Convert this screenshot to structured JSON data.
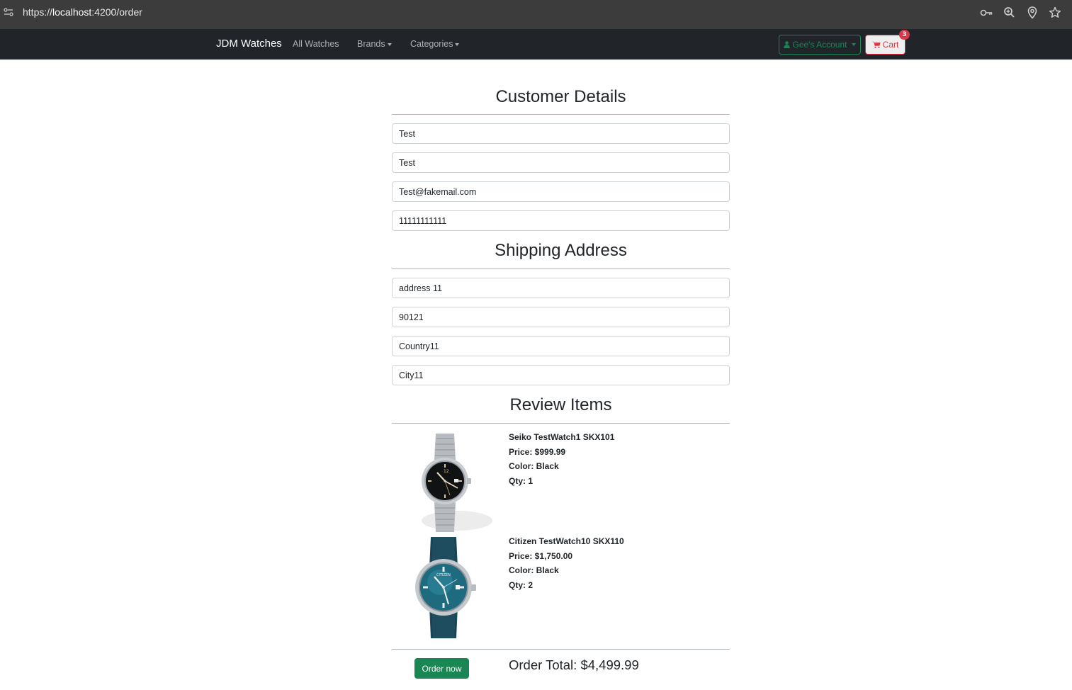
{
  "browser": {
    "url_prefix": "https://",
    "url_host": "localhost",
    "url_rest": ":4200/order"
  },
  "navbar": {
    "brand": "JDM Watches",
    "links": [
      "All Watches",
      "Brands",
      "Categories"
    ],
    "account_label": "Gee's Account",
    "cart_label": "Cart",
    "cart_count": "3"
  },
  "customer": {
    "title": "Customer Details",
    "first_name": "Test",
    "last_name": "Test",
    "email": "Test@fakemail.com",
    "phone": "11111111111"
  },
  "shipping": {
    "title": "Shipping Address",
    "address": "address 11",
    "zip": "90121",
    "country": "Country11",
    "city": "City11"
  },
  "review": {
    "title": "Review Items",
    "items": [
      {
        "name": "Seiko TestWatch1 SKX101",
        "price": "Price: $999.99",
        "color": "Color: Black",
        "qty": "Qty: 1"
      },
      {
        "name": "Citizen TestWatch10 SKX110",
        "price": "Price: $1,750.00",
        "color": "Color: Black",
        "qty": "Qty: 2"
      }
    ]
  },
  "order": {
    "button_label": "Order now",
    "total": "Order Total: $4,499.99"
  },
  "colors": {
    "navbar_bg": "#212529",
    "success": "#198754",
    "danger": "#dc3545"
  }
}
